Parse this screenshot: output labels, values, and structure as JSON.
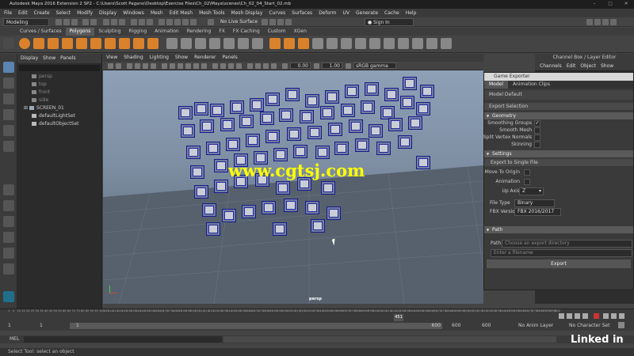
{
  "window": {
    "title": "Autodesk Maya 2016 Extension 2 SP2 - C:\\Users\\Scott Pagano\\Desktop\\Exercise Files\\Ch_02\\Maya\\scenes\\Ch_02_04_Start_02.mb"
  },
  "menu": [
    "File",
    "Edit",
    "Create",
    "Select",
    "Modify",
    "Display",
    "Windows",
    "Mesh",
    "Edit Mesh",
    "Mesh Tools",
    "Mesh Display",
    "Curves",
    "Surfaces",
    "Deform",
    "UV",
    "Generate",
    "Cache",
    "Help"
  ],
  "status": {
    "mode": "Modeling",
    "live_surface": "No Live Surface",
    "sign_in": "Sign In"
  },
  "shelf_tabs": [
    "Curves / Surfaces",
    "Polygons",
    "Sculpting",
    "Rigging",
    "Animation",
    "Rendering",
    "FX",
    "FX Caching",
    "Custom",
    "XGen"
  ],
  "active_shelf_tab": "Polygons",
  "outliner": {
    "menu": [
      "Display",
      "Show",
      "Panels"
    ],
    "items": [
      "persp",
      "top",
      "front",
      "side",
      "SCREEN_01",
      "defaultLightSet",
      "defaultObjectSet"
    ]
  },
  "viewport": {
    "menu": [
      "View",
      "Shading",
      "Lighting",
      "Show",
      "Renderer",
      "Panels"
    ],
    "value1": "0.00",
    "value2": "1.00",
    "color_space": "sRGB gamma",
    "camera_label": "persp"
  },
  "channel_box": {
    "title": "Channel Box / Layer Editor",
    "menu": [
      "Channels",
      "Edit",
      "Object",
      "Show"
    ]
  },
  "exporter": {
    "title": "Game Exporter",
    "tabs": [
      "Model",
      "Animation Clips"
    ],
    "preset": "Model Default",
    "export_selection": "Export Selection",
    "geometry_header": "Geometry",
    "smoothing_groups": "Smoothing Groups",
    "smooth_mesh": "Smooth Mesh",
    "split_vertex_normals": "Split Vertex Normals",
    "skinning": "Skinning",
    "settings_header": "Settings",
    "export_mode": "Export to Single File",
    "move_to_origin": "Move To Origin",
    "animation": "Animation",
    "up_axis_label": "Up Axis",
    "up_axis": "Z",
    "file_type_label": "File Type",
    "file_type": "Binary",
    "fbx_version_label": "FBX Version",
    "fbx_version": "FBX 2016/2017",
    "path_header": "Path",
    "path_label": "Path",
    "path_placeholder": "Choose an export directory",
    "filename_placeholder": "Enter a filename",
    "export_button": "Export"
  },
  "timeline": {
    "ticks": [
      "1",
      "5",
      "10",
      "15",
      "20",
      "25",
      "30",
      "35",
      "40",
      "45",
      "50",
      "55",
      "60",
      "65",
      "70",
      "75",
      "80",
      "85",
      "90",
      "95",
      "100",
      "105",
      "110",
      "115",
      "120",
      "125",
      "130",
      "135",
      "140",
      "145",
      "150",
      "155",
      "160",
      "165",
      "170",
      "175",
      "180",
      "185",
      "190",
      "195",
      "200",
      "205",
      "210",
      "215",
      "220",
      "225",
      "230",
      "235",
      "240",
      "245",
      "250",
      "255",
      "260",
      "265",
      "270",
      "275",
      "280",
      "285",
      "290",
      "295",
      "300",
      "305",
      "310",
      "315",
      "320",
      "325",
      "330",
      "335",
      "340",
      "345",
      "350",
      "355",
      "360",
      "365",
      "370",
      "375",
      "380",
      "385",
      "390",
      "395",
      "400",
      "405",
      "410",
      "415",
      "420",
      "425",
      "430",
      "435",
      "440",
      "445",
      "450",
      "455",
      "460",
      "465",
      "470",
      "475",
      "480",
      "485",
      "490",
      "495",
      "500",
      "505",
      "510",
      "515",
      "520",
      "525",
      "530",
      "535",
      "540",
      "545",
      "550",
      "555",
      "560",
      "565",
      "570",
      "575",
      "580",
      "585",
      "590",
      "595",
      "600"
    ],
    "current_frame": "451",
    "start": "1",
    "start2": "1",
    "range_marker": "1",
    "range_end": "600",
    "end": "600",
    "end2": "600",
    "anim_layer": "No Anim Layer",
    "character_set": "No Character Set"
  },
  "command_line": {
    "label": "MEL"
  },
  "help_line": "Select Tool: select an object",
  "watermark": "www.cgtsj.com",
  "brand": "Linked in"
}
